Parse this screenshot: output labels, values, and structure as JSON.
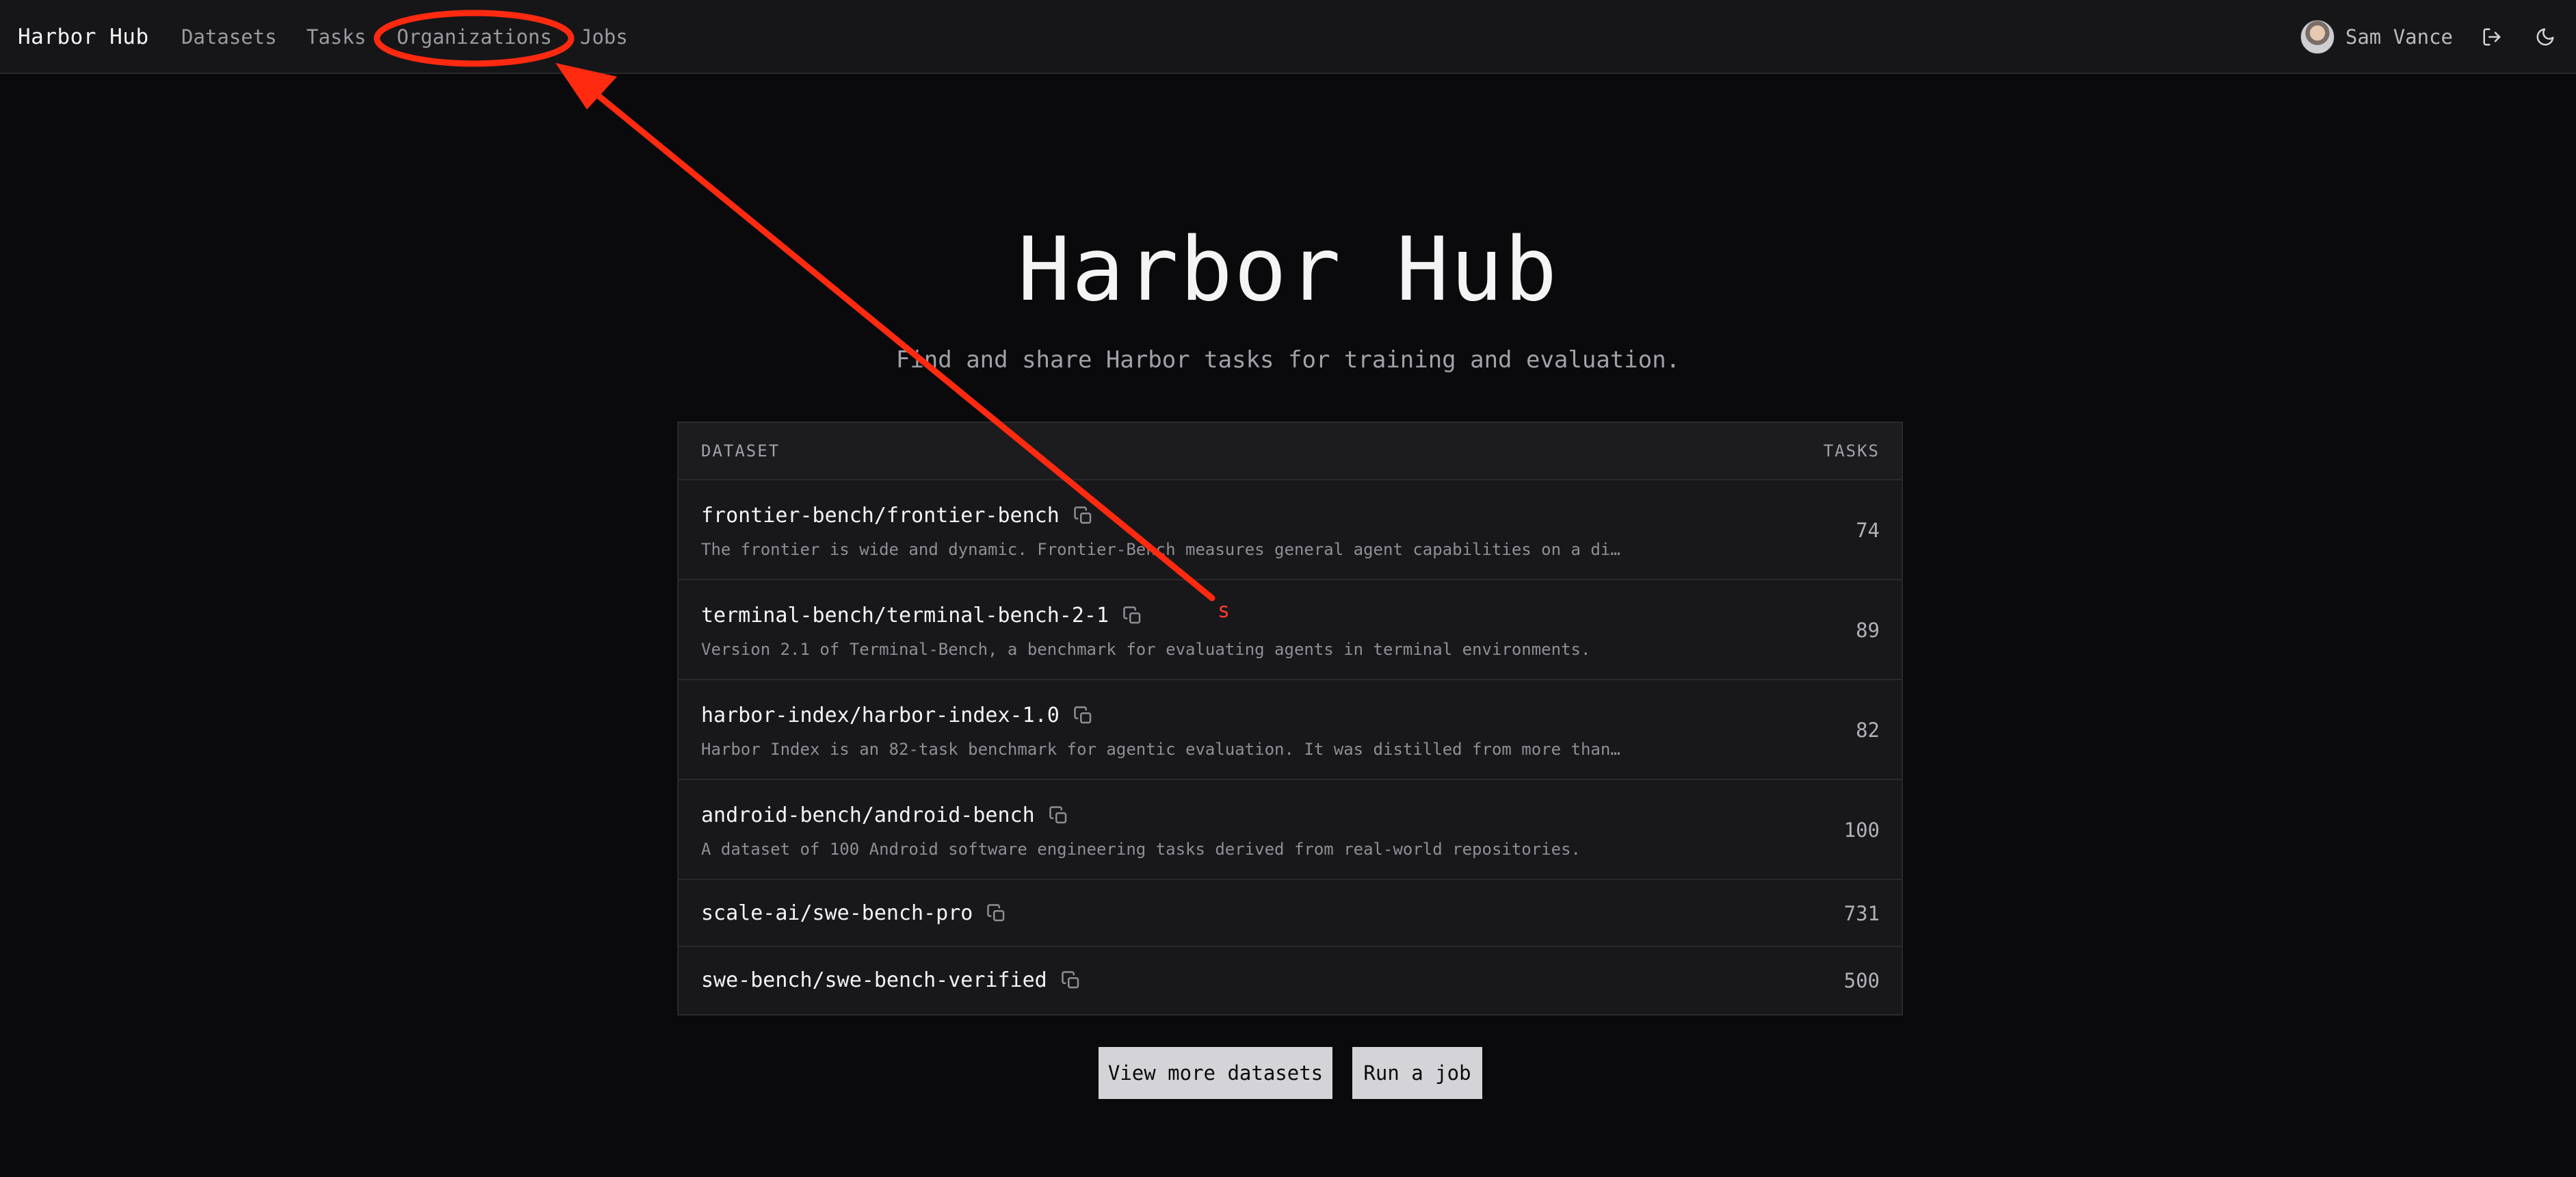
{
  "nav": {
    "brand": "Harbor Hub",
    "links": {
      "datasets": "Datasets",
      "tasks": "Tasks",
      "organizations": "Organizations",
      "jobs": "Jobs"
    },
    "user_name": "Sam Vance"
  },
  "hero": {
    "title": "Harbor Hub",
    "subtitle": "Find and share Harbor tasks for training and evaluation."
  },
  "table": {
    "headers": {
      "dataset": "DATASET",
      "tasks": "TASKS"
    },
    "rows": [
      {
        "name": "frontier-bench/frontier-bench",
        "description": "The frontier is wide and dynamic. Frontier-Bench measures general agent capabilities on a di…",
        "tasks": "74"
      },
      {
        "name": "terminal-bench/terminal-bench-2-1",
        "description": "Version 2.1 of Terminal-Bench, a benchmark for evaluating agents in terminal environments.",
        "tasks": "89"
      },
      {
        "name": "harbor-index/harbor-index-1.0",
        "description": "Harbor Index is an 82-task benchmark for agentic evaluation. It was distilled from more than…",
        "tasks": "82"
      },
      {
        "name": "android-bench/android-bench",
        "description": "A dataset of 100 Android software engineering tasks derived from real-world repositories.",
        "tasks": "100"
      },
      {
        "name": "scale-ai/swe-bench-pro",
        "description": "",
        "tasks": "731"
      },
      {
        "name": "swe-bench/swe-bench-verified",
        "description": "",
        "tasks": "500"
      }
    ]
  },
  "buttons": {
    "view_more": "View more datasets",
    "run_job": "Run a job"
  },
  "annotation": {
    "mark": "s",
    "color": "#ff2a10"
  },
  "colors": {
    "background": "#0a0a0c",
    "nav_background": "#161618",
    "button_background": "#d4d4d8"
  }
}
